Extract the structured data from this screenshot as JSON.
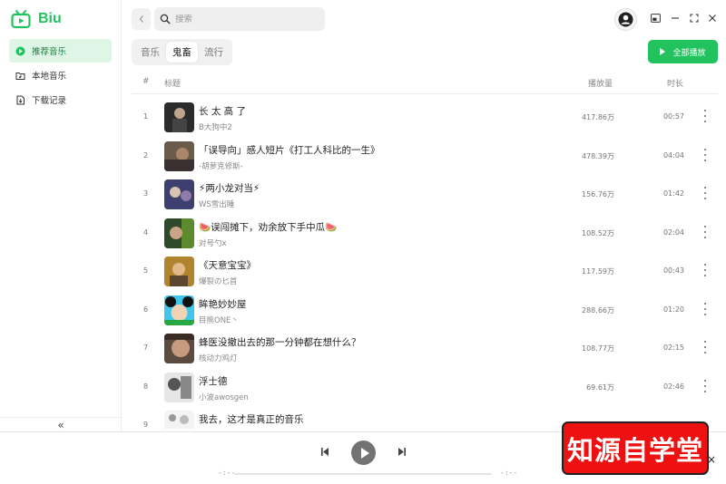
{
  "app": {
    "name": "Biu",
    "brand_color": "#22c35e"
  },
  "sidebar": {
    "items": [
      {
        "label": "推荐音乐",
        "icon": "recommend-icon",
        "active": true
      },
      {
        "label": "本地音乐",
        "icon": "folder-music-icon",
        "active": false
      },
      {
        "label": "下载记录",
        "icon": "download-icon",
        "active": false
      }
    ],
    "collapse_label": "«"
  },
  "header": {
    "search": {
      "placeholder": "搜索",
      "value": ""
    }
  },
  "tabs": [
    {
      "label": "音乐",
      "active": false
    },
    {
      "label": "鬼畜",
      "active": true
    },
    {
      "label": "流行",
      "active": false
    }
  ],
  "play_all_label": "全部播放",
  "table": {
    "columns": {
      "index": "#",
      "title": "标题",
      "plays": "播放量",
      "duration": "时长"
    },
    "rows": [
      {
        "index": "1",
        "title": "长 太 高 了",
        "author": "B大狗中2",
        "plays": "417.86万",
        "duration": "00:57"
      },
      {
        "index": "2",
        "title": "「误导向」感人短片《打工人科比的一生》",
        "author": "-胡萝克修斯-",
        "plays": "478.39万",
        "duration": "04:04"
      },
      {
        "index": "3",
        "title": "⚡两小龙对当⚡",
        "author": "WS雪出睡",
        "plays": "156.76万",
        "duration": "01:42"
      },
      {
        "index": "4",
        "title": "🍉误闯摊下，劝余放下手中瓜🍉",
        "author": "对号勺x",
        "plays": "108.52万",
        "duration": "02:04"
      },
      {
        "index": "5",
        "title": "《天意宝宝》",
        "author": "爆裂の匕首",
        "plays": "117.59万",
        "duration": "00:43"
      },
      {
        "index": "6",
        "title": "眸艳妙妙屋",
        "author": "目熊ONE丶",
        "plays": "288.66万",
        "duration": "01:20"
      },
      {
        "index": "7",
        "title": "蜂医没撤出去的那一分钟都在想什么？",
        "author": "核动力鸡灯",
        "plays": "108.77万",
        "duration": "02:15"
      },
      {
        "index": "8",
        "title": "浮士德",
        "author": "小波awosgen",
        "plays": "69.61万",
        "duration": "02:46"
      },
      {
        "index": "9",
        "title": "我去，这才是真正的音乐",
        "author": "",
        "plays": "",
        "duration": ""
      }
    ]
  },
  "player": {
    "current_time": "-:--",
    "total_time": "-:--",
    "progress": 0
  },
  "watermark": {
    "text": "知源自学堂",
    "close": "×"
  }
}
